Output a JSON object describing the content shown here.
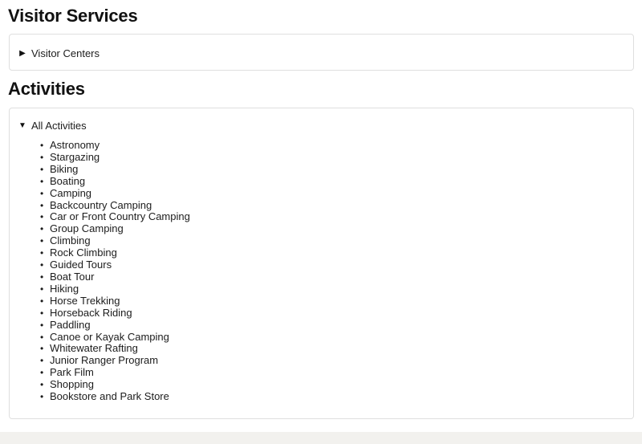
{
  "sections": [
    {
      "heading": "Visitor Services",
      "disclosure": {
        "label": "Visitor Centers",
        "state": "collapsed",
        "marker_icon": "triangle-right-icon"
      }
    },
    {
      "heading": "Activities",
      "disclosure": {
        "label": "All Activities",
        "state": "expanded",
        "marker_icon": "triangle-down-icon"
      },
      "items": [
        "Astronomy",
        "Stargazing",
        "Biking",
        "Boating",
        "Camping",
        "Backcountry Camping",
        "Car or Front Country Camping",
        "Group Camping",
        "Climbing",
        "Rock Climbing",
        "Guided Tours",
        "Boat Tour",
        "Hiking",
        "Horse Trekking",
        "Horseback Riding",
        "Paddling",
        "Canoe or Kayak Camping",
        "Whitewater Rafting",
        "Junior Ranger Program",
        "Park Film",
        "Shopping",
        "Bookstore and Park Store"
      ]
    }
  ],
  "colors": {
    "text": "#1c1c1c",
    "heading": "#111111",
    "card_border": "#dfdfdf",
    "page_background": "#ffffff",
    "footer_strip": "#f2f1ee"
  }
}
